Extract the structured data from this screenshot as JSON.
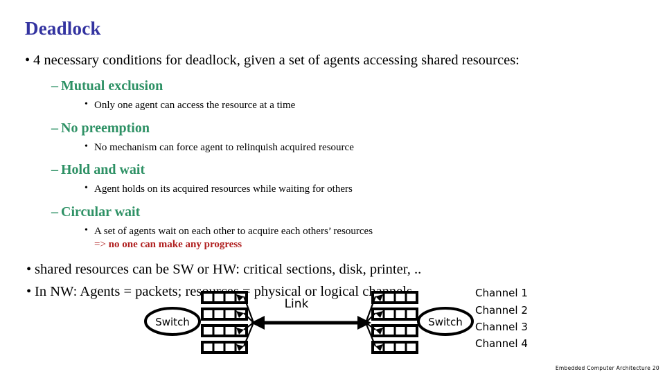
{
  "slide": {
    "title": "Deadlock",
    "footer": "Embedded Computer Architecture  20"
  },
  "colors": {
    "title": "#3333a0",
    "heading_green": "#2e9165",
    "emphasis_red": "#b02020",
    "body_black": "#000000",
    "background": "#ffffff"
  },
  "bullets": {
    "intro": "4 necessary conditions for deadlock, given a set of agents accessing shared resources:",
    "intro_marker": "•",
    "dash_marker": "–",
    "sub_marker": "•",
    "conditions": [
      {
        "name": "Mutual exclusion",
        "detail": "Only one agent can access the resource at a time"
      },
      {
        "name": "No preemption",
        "detail": "No mechanism can force agent to relinquish acquired resource"
      },
      {
        "name": "Hold and wait",
        "detail": "Agent holds on its acquired resources while waiting for others"
      },
      {
        "name": "Circular wait",
        "detail": "A set of agents wait on each other to acquire each others’ resources"
      }
    ],
    "progress_arrow": "=> ",
    "progress_text": "no one can make any progress",
    "closing": [
      "shared resources can be SW or HW: critical sections, disk, printer, ..",
      "In NW: Agents = packets; resources = physical or logical channels"
    ]
  },
  "diagram": {
    "left_switch_label": "Switch",
    "right_switch_label": "Switch",
    "link_label": "Link",
    "channels": [
      "Channel 1",
      "Channel 2",
      "Channel 3",
      "Channel 4"
    ],
    "queue_count": 4,
    "cells_per_queue": 4
  }
}
